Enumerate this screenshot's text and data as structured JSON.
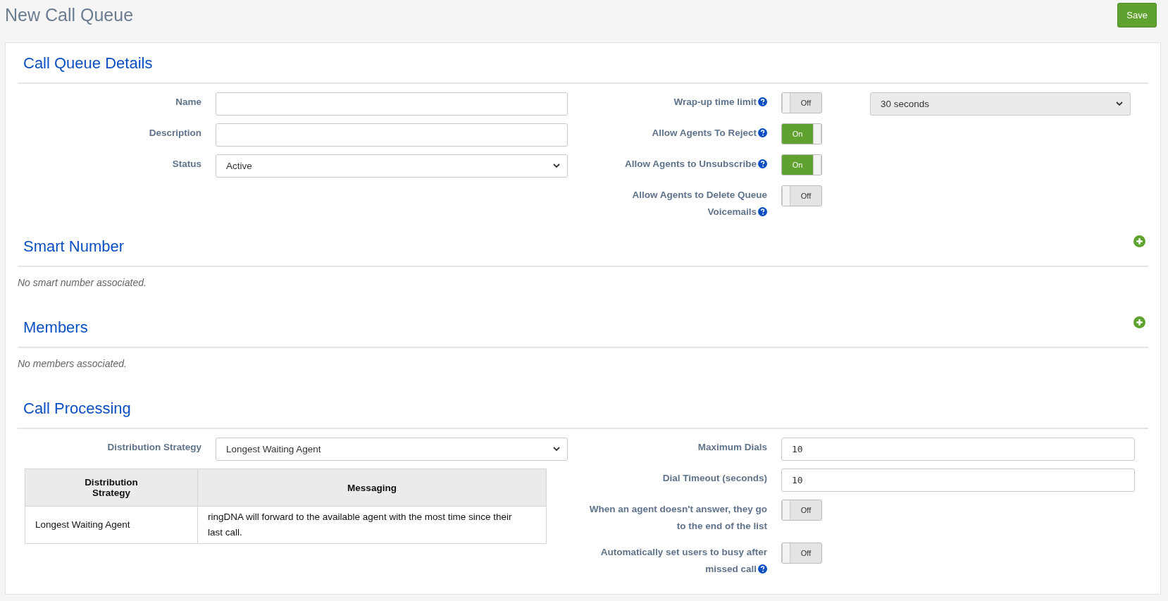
{
  "page": {
    "title": "New Call Queue",
    "save_button": "Save"
  },
  "sections": [
    {
      "heading": "Call Queue Details",
      "add": false,
      "left_fields": [
        {
          "kind": "text",
          "label": "Name"
        },
        {
          "kind": "text",
          "label": "Description"
        },
        {
          "kind": "select",
          "label": "Status",
          "value": "Active"
        }
      ],
      "right_fields": [
        {
          "kind": "toggle_select",
          "label": "Wrap-up time limit",
          "help": true,
          "on": false,
          "toggle_text": "Off",
          "select_value": "30 seconds",
          "select_disabled": true
        },
        {
          "kind": "toggle",
          "label": "Allow Agents To Reject",
          "help": true,
          "on": true,
          "toggle_text": "On"
        },
        {
          "kind": "toggle",
          "label": "Allow Agents to Unsubscribe",
          "help": true,
          "on": true,
          "toggle_text": "On"
        },
        {
          "kind": "toggle",
          "label": "Allow Agents to Delete Queue Voicemails",
          "help": true,
          "on": false,
          "toggle_text": "Off"
        }
      ]
    },
    {
      "heading": "Smart Number",
      "add": true,
      "empty_text": "No smart number associated."
    },
    {
      "heading": "Members",
      "add": true,
      "empty_text": "No members associated."
    },
    {
      "heading": "Call Processing",
      "add": false,
      "left_fields": [
        {
          "kind": "select",
          "label": "Distribution Strategy",
          "value": "Longest Waiting Agent"
        }
      ],
      "table": {
        "columns": [
          "Distribution Strategy",
          "Messaging"
        ],
        "rows": [
          [
            "Longest Waiting Agent",
            "ringDNA will forward to the available agent with the most time since their last call."
          ]
        ]
      },
      "right_fields": [
        {
          "kind": "text",
          "label": "Maximum Dials",
          "value": "10"
        },
        {
          "kind": "text",
          "label": "Dial Timeout (seconds)",
          "value": "10"
        },
        {
          "kind": "toggle",
          "label": "When an agent doesn't answer, they go to the end of the list",
          "help": false,
          "on": false,
          "toggle_text": "Off"
        },
        {
          "kind": "toggle",
          "label": "Automatically set users to busy after missed call",
          "help": true,
          "on": false,
          "toggle_text": "Off"
        }
      ]
    }
  ]
}
